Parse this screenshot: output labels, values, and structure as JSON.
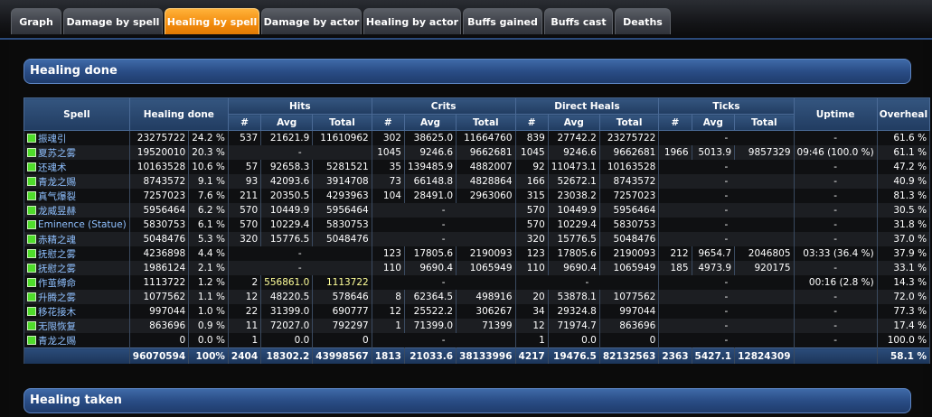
{
  "tabs": [
    {
      "label": "Graph",
      "active": false
    },
    {
      "label": "Damage by spell",
      "active": false
    },
    {
      "label": "Healing by spell",
      "active": true
    },
    {
      "label": "Damage by actor",
      "active": false
    },
    {
      "label": "Healing by actor",
      "active": false
    },
    {
      "label": "Buffs gained",
      "active": false
    },
    {
      "label": "Buffs cast",
      "active": false
    },
    {
      "label": "Deaths",
      "active": false
    }
  ],
  "sections": {
    "healing_done": "Healing done",
    "healing_taken": "Healing taken"
  },
  "table": {
    "headers": {
      "spell": "Spell",
      "healing_done": "Healing done",
      "hits": "Hits",
      "crits": "Crits",
      "direct": "Direct Heals",
      "ticks": "Ticks",
      "uptime": "Uptime",
      "overheal": "Overheal",
      "count": "#",
      "avg": "Avg",
      "total": "Total"
    },
    "rows": [
      [
        "振魂引",
        "23275722",
        "24.2 %",
        "537",
        "21621.9",
        "11610962",
        "302",
        "38625.0",
        "11664760",
        "839",
        "27742.2",
        "23275722",
        "-",
        "",
        "",
        "-",
        "61.6 %"
      ],
      [
        "夏苏之雾",
        "19520010",
        "20.3 %",
        "-",
        "",
        "",
        "1045",
        "9246.6",
        "9662681",
        "1045",
        "9246.6",
        "9662681",
        "1966",
        "5013.9",
        "9857329",
        "09:46 (100.0 %)",
        "61.1 %"
      ],
      [
        "还魂术",
        "10163528",
        "10.6 %",
        "57",
        "92658.3",
        "5281521",
        "35",
        "139485.9",
        "4882007",
        "92",
        "110473.1",
        "10163528",
        "-",
        "",
        "",
        "-",
        "47.2 %"
      ],
      [
        "青龙之赐",
        "8743572",
        "9.1 %",
        "93",
        "42093.6",
        "3914708",
        "73",
        "66148.8",
        "4828864",
        "166",
        "52672.1",
        "8743572",
        "-",
        "",
        "",
        "-",
        "40.9 %"
      ],
      [
        "真气爆裂",
        "7257023",
        "7.6 %",
        "211",
        "20350.5",
        "4293963",
        "104",
        "28491.0",
        "2963060",
        "315",
        "23038.2",
        "7257023",
        "-",
        "",
        "",
        "-",
        "81.3 %"
      ],
      [
        "龙威昱赫",
        "5956464",
        "6.2 %",
        "570",
        "10449.9",
        "5956464",
        "-",
        "",
        "",
        "570",
        "10449.9",
        "5956464",
        "-",
        "",
        "",
        "-",
        "30.5 %"
      ],
      [
        "Eminence (Statue)",
        "5830753",
        "6.1 %",
        "570",
        "10229.4",
        "5830753",
        "-",
        "",
        "",
        "570",
        "10229.4",
        "5830753",
        "-",
        "",
        "",
        "-",
        "31.8 %"
      ],
      [
        "赤精之魂",
        "5048476",
        "5.3 %",
        "320",
        "15776.5",
        "5048476",
        "-",
        "",
        "",
        "320",
        "15776.5",
        "5048476",
        "-",
        "",
        "",
        "-",
        "37.0 %"
      ],
      [
        "抚慰之雾",
        "4236898",
        "4.4 %",
        "-",
        "",
        "",
        "123",
        "17805.6",
        "2190093",
        "123",
        "17805.6",
        "2190093",
        "212",
        "9654.7",
        "2046805",
        "03:33 (36.4 %)",
        "37.9 %"
      ],
      [
        "抚慰之雾",
        "1986124",
        "2.1 %",
        "-",
        "",
        "",
        "110",
        "9690.4",
        "1065949",
        "110",
        "9690.4",
        "1065949",
        "185",
        "4973.9",
        "920175",
        "-",
        "33.1 %"
      ],
      [
        "作茧缚命",
        "1113722",
        "1.2 %",
        "2",
        "556861.0",
        "1113722",
        "-",
        "",
        "",
        "-",
        "",
        "",
        "-",
        "",
        "",
        "00:16 (2.8 %)",
        "14.3 %"
      ],
      [
        "升腾之雾",
        "1077562",
        "1.1 %",
        "12",
        "48220.5",
        "578646",
        "8",
        "62364.5",
        "498916",
        "20",
        "53878.1",
        "1077562",
        "-",
        "",
        "",
        "-",
        "72.0 %"
      ],
      [
        "移花接木",
        "997044",
        "1.0 %",
        "22",
        "31399.0",
        "690777",
        "12",
        "25522.2",
        "306267",
        "34",
        "29324.8",
        "997044",
        "-",
        "",
        "",
        "-",
        "77.3 %"
      ],
      [
        "无限恢复",
        "863696",
        "0.9 %",
        "11",
        "72027.0",
        "792297",
        "1",
        "71399.0",
        "71399",
        "12",
        "71974.7",
        "863696",
        "-",
        "",
        "",
        "-",
        "17.4 %"
      ],
      [
        "青龙之赐",
        "0",
        "0.0 %",
        "1",
        "0.0",
        "0",
        "-",
        "",
        "",
        "1",
        "0.0",
        "0",
        "-",
        "",
        "",
        "-",
        "100.0 %"
      ]
    ],
    "totals": [
      "",
      "96070594",
      "100%",
      "2404",
      "18302.2",
      "43998567",
      "1813",
      "21033.6",
      "38133996",
      "4217",
      "19476.5",
      "82132563",
      "2363",
      "5427.1",
      "12824309",
      "",
      "58.1 %"
    ]
  }
}
